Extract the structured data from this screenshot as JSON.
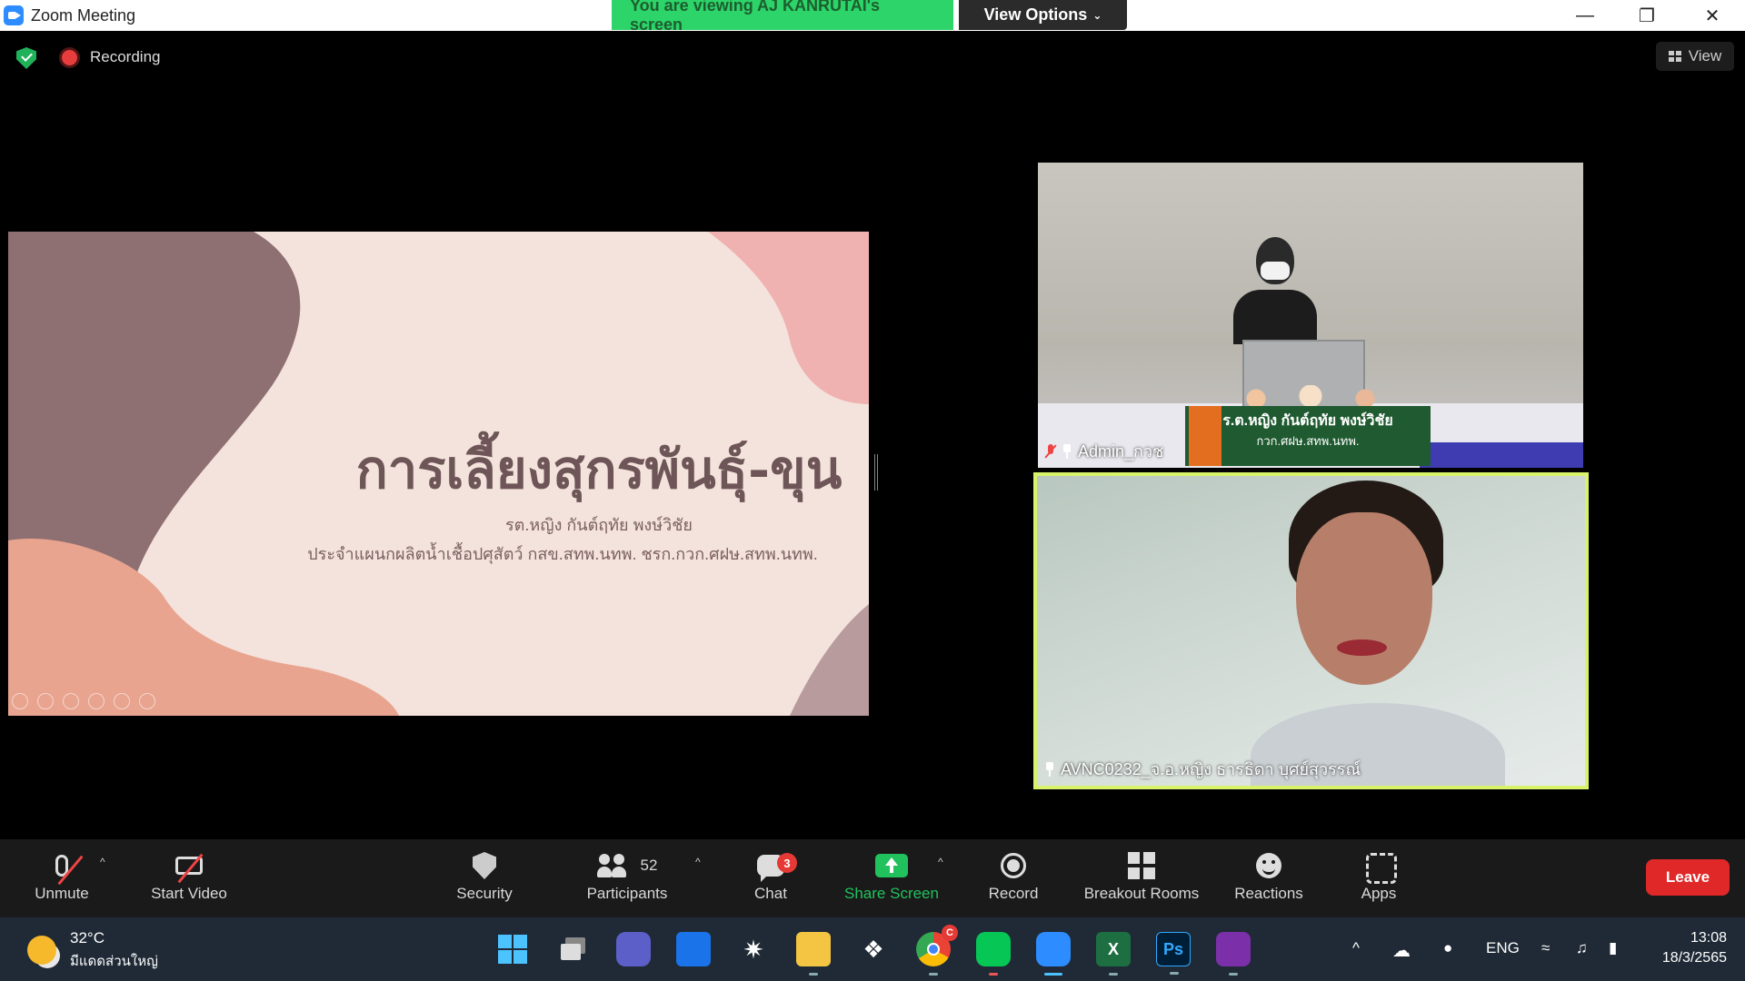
{
  "window": {
    "title": "Zoom Meeting",
    "share_banner": "You are viewing AJ KANRUTAI's screen",
    "view_options": "View Options"
  },
  "meeting_bar": {
    "recording": "Recording",
    "view": "View"
  },
  "slide": {
    "title": "การเลี้ยงสุกรพันธุ์-ขุน",
    "author": "รต.หญิง กันต์ฤทัย พงษ์วิชัย",
    "affiliation": "ประจำแผนกผลิตน้ำเชื้อปศุสัตว์ กสข.สทพ.นทพ. ชรก.กวก.ศฝษ.สทพ.นทพ."
  },
  "videos": [
    {
      "name": "Admin_กวช",
      "banner_line1": "ร.ต.หญิง กันต์ฤทัย  พงษ์วิชัย",
      "banner_line2": "กวก.ศฝษ.สทพ.นทพ."
    },
    {
      "name": "AVNC0232_จ.อ.หญิง ธารธิดา  บุศย์สุวรรณ์"
    }
  ],
  "toolbar": {
    "unmute": "Unmute",
    "start_video": "Start Video",
    "security": "Security",
    "participants": "Participants",
    "participants_count": "52",
    "chat": "Chat",
    "chat_badge": "3",
    "share_screen": "Share Screen",
    "record": "Record",
    "breakout_rooms": "Breakout Rooms",
    "reactions": "Reactions",
    "apps": "Apps",
    "leave": "Leave"
  },
  "taskbar": {
    "weather_temp": "32°C",
    "weather_desc": "มีแดดส่วนใหญ่",
    "language": "ENG",
    "time": "13:08",
    "date": "18/3/2565",
    "excel_label": "X",
    "photoshop_label": "Ps",
    "chrome_badge": "C"
  },
  "colors": {
    "share_green": "#2dd46a",
    "leave_red": "#e02828",
    "active_speaker": "#d8f36a"
  }
}
